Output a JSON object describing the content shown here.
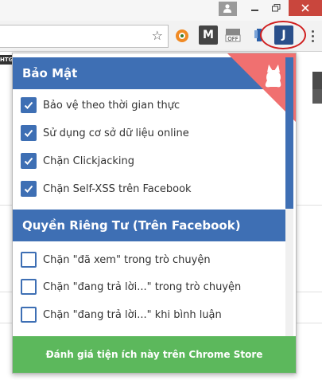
{
  "browser": {
    "bookmark_badge": "HTG",
    "extensions": [
      {
        "name": "ext-orange"
      },
      {
        "name": "ext-m",
        "label": "M"
      },
      {
        "name": "ext-off",
        "label": "OFF"
      },
      {
        "name": "ext-blue-1"
      },
      {
        "name": "ext-j-active",
        "label": "J"
      }
    ]
  },
  "popup": {
    "security": {
      "title": "Bảo Mật",
      "items": [
        {
          "label": "Bảo vệ theo thời gian thực",
          "checked": true
        },
        {
          "label": "Sử dụng cơ sở dữ liệu online",
          "checked": true
        },
        {
          "label": "Chặn Clickjacking",
          "checked": true
        },
        {
          "label": "Chặn Self-XSS trên Facebook",
          "checked": true
        }
      ]
    },
    "privacy": {
      "title": "Quyền Riêng Tư (Trên Facebook)",
      "items": [
        {
          "label": "Chặn \"đã xem\" trong trò chuyện",
          "checked": false
        },
        {
          "label": "Chặn \"đang trả lời...\" trong trò chuyện",
          "checked": false
        },
        {
          "label": "Chặn \"đang trả lời...\" khi bình luận",
          "checked": false
        }
      ]
    },
    "footer_button": "Đánh giá tiện ích này trên Chrome Store",
    "colors": {
      "header": "#3e6fb4",
      "footer": "#5cb85c",
      "ribbon": "#f07070"
    }
  }
}
